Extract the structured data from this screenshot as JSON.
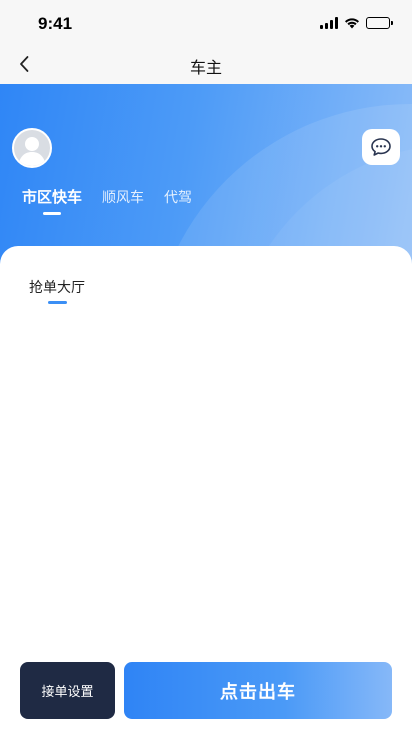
{
  "status_bar": {
    "time": "9:41"
  },
  "nav": {
    "title": "车主"
  },
  "hero": {
    "tabs": [
      {
        "label": "市区快车",
        "active": true
      },
      {
        "label": "顺风车",
        "active": false
      },
      {
        "label": "代驾",
        "active": false
      }
    ]
  },
  "content": {
    "sub_tab": "抢单大厅"
  },
  "actions": {
    "settings_label": "接单设置",
    "depart_label": "点击出车"
  },
  "colors": {
    "primary_blue": "#2f86f6",
    "dark_button": "#1f2a44"
  }
}
